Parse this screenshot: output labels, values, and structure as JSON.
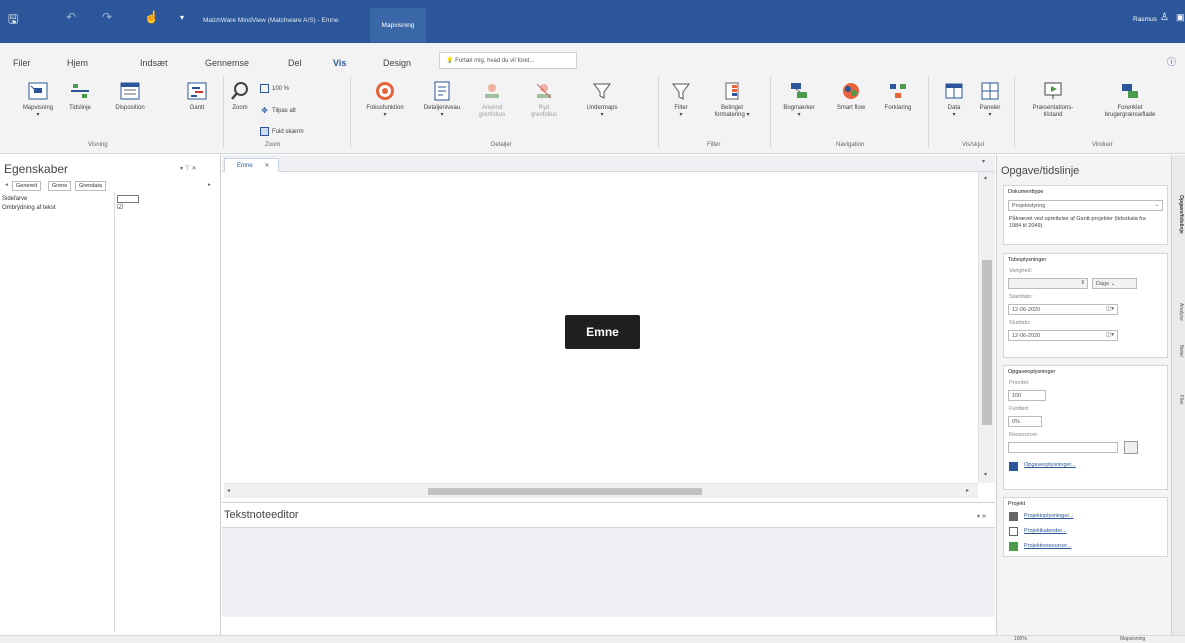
{
  "titlebar": {
    "app_title": "MatchWare MindView (Matchware A/S) - Emne",
    "context_tab": "Mapvisning",
    "user": "Rasmus",
    "colors": {
      "bar": "#2b579a"
    }
  },
  "ribbon_tabs": [
    "Filer",
    "Hjem",
    "Indsæt",
    "Gennemse",
    "Del",
    "Vis",
    "Design"
  ],
  "active_tab": "Vis",
  "tell_me": "Fortæl mig, hvad du vil foret...",
  "ribbon": {
    "visning": {
      "label": "Visning",
      "buttons": [
        "Mapvisning",
        "Tidslinje",
        "Disposition",
        "Gantt"
      ]
    },
    "zoom": {
      "label": "Zoom",
      "zoom_button": "Zoom",
      "pct": "100 %",
      "fit": "Tilpas alt",
      "full": "Fuld skærm"
    },
    "detaljer": {
      "label": "Detaljer",
      "buttons": [
        "Fokusfunktion",
        "Detaljeniveau",
        "Anvend grenfokus",
        "Ryd grenfokus",
        "Undermaps"
      ]
    },
    "filter": {
      "label": "Filter",
      "buttons": [
        "Filter",
        "Betinget formatering"
      ]
    },
    "navigation": {
      "label": "Navigation",
      "buttons": [
        "Bogmærker",
        "Smart flow",
        "Forklaring"
      ]
    },
    "vis_skjul": {
      "label": "Vis/skjul",
      "buttons": [
        "Data",
        "Paneler"
      ]
    },
    "vinduer": {
      "label": "Vinduer",
      "buttons": [
        "Præsentations-tilstand",
        "Forenklet brugergrænseflade"
      ]
    }
  },
  "left_pane": {
    "title": "Egenskaber",
    "tabs": [
      "Generelt",
      "Grene",
      "Grendata"
    ],
    "rows": [
      {
        "name": "Sidefarve",
        "value": ""
      },
      {
        "name": "Ombrydning af tekst",
        "value": "☑"
      }
    ]
  },
  "document": {
    "tab": "Emne",
    "root_topic": "Emne"
  },
  "notes": {
    "title": "Tekstnoteeditor"
  },
  "right_pane": {
    "title": "Opgave/tidslinje",
    "dokumenttype": {
      "label": "Dokumenttype",
      "value": "Projektstyring",
      "description": "Påkrævet ved oprettelse af Gantt-projekter (tidsskala fra 1984 til 2049)."
    },
    "tidsoplysninger": {
      "label": "Tidsoplysninger",
      "varighed_label": "Varighed:",
      "unit": "Dage",
      "startdato_label": "Startdato:",
      "startdato": "12-06-2020",
      "slutdato_label": "Slutdato:",
      "slutdato": "12-06-2020"
    },
    "opgave": {
      "label": "Opgaveoplysninger",
      "prioritet_label": "Prioritet:",
      "prioritet": "100",
      "fuldfort_label": "Fuldført:",
      "fuldfort": "0%",
      "ressourcer_label": "Ressourcer:",
      "link": "Opgaveoplysninger..."
    },
    "projekt": {
      "label": "Projekt",
      "links": [
        "Projektoplysninger...",
        "Projektkalender...",
        "Projektressourcer..."
      ]
    }
  },
  "side_tabs": [
    "Opgave/tidslinje",
    "Analyse",
    "Noter",
    "Filer"
  ],
  "status": {
    "zoom": "100%",
    "view": "Mapvisning"
  }
}
